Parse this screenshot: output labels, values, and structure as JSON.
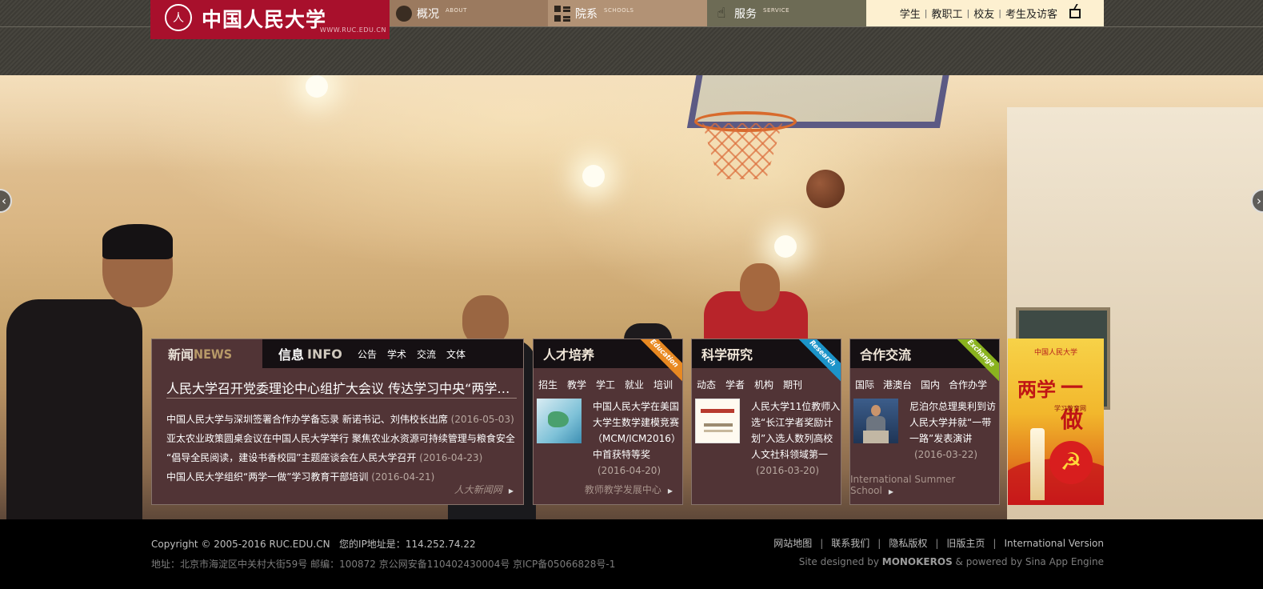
{
  "header": {
    "logo_name": "中国人民大学",
    "logo_seal": "人",
    "logo_url": "WWW.RUC.EDU.CN",
    "nav": [
      {
        "label": "概况",
        "sub": "ABOUT",
        "icon": "globe-icon"
      },
      {
        "label": "院系",
        "sub": "SCHOOLS",
        "icon": "grid-icon"
      },
      {
        "label": "服务",
        "sub": "SERVICE",
        "icon": "hand-pointer-icon"
      }
    ],
    "quick_links": [
      "学生",
      "教职工",
      "校友",
      "考生及访客"
    ],
    "quick_sep": "|",
    "tv_icon": "tv-icon"
  },
  "slider": {
    "prev": "‹",
    "next": "›"
  },
  "news": {
    "tab_news_cn": "新闻",
    "tab_news_en": "NEWS",
    "tab_info_cn": "信息",
    "tab_info_en": "INFO",
    "info_subtabs": [
      "公告",
      "学术",
      "交流",
      "文体"
    ],
    "headline": "人民大学召开党委理论中心组扩大会议 传达学习中央“两学一做”学习教育工作座谈会精神",
    "items": [
      {
        "title": "中国人民大学与深圳签署合作办学备忘录 新诺书记、刘伟校长出席",
        "date": "(2016-05-03)"
      },
      {
        "title": "亚太农业政策圆桌会议在中国人民大学举行 聚焦农业水资源可持续管理与粮食安全",
        "date": ""
      },
      {
        "title": "“倡导全民阅读，建设书香校园”主题座谈会在人民大学召开",
        "date": "(2016-04-23)"
      },
      {
        "title": "中国人民大学组织“两学一做”学习教育干部培训",
        "date": "(2016-04-21)"
      }
    ],
    "more": "人大新闻网"
  },
  "talent": {
    "title": "人才培养",
    "ribbon": "Education",
    "cats": [
      "招生",
      "教学",
      "学工",
      "就业",
      "培训"
    ],
    "item_text": "中国人民大学在美国大学生数学建模竞赛（MCM/ICM2016）中首获特等奖",
    "item_date": "(2016-04-20)",
    "more": "教师教学发展中心"
  },
  "research": {
    "title": "科学研究",
    "ribbon": "Research",
    "cats": [
      "动态",
      "学者",
      "机构",
      "期刊"
    ],
    "item_text": "人民大学11位教师入选“长江学者奖励计划”入选人数列高校人文社科领域第一",
    "item_date": "(2016-03-20)"
  },
  "coop": {
    "title": "合作交流",
    "ribbon": "Exchange",
    "cats": [
      "国际",
      "港澳台",
      "国内",
      "合作办学"
    ],
    "item_text": "尼泊尔总理奥利到访人民大学并就“一带一路”发表演讲",
    "item_date": "(2016-03-22)",
    "more": "International Summer School"
  },
  "promo": {
    "brand": "中国人民大学",
    "big1": "两",
    "big1b": "学",
    "big2": "一做",
    "sub": "学习教育网",
    "emblem": "☭"
  },
  "footer": {
    "copyright": "Copyright © 2005-2016 RUC.EDU.CN",
    "ip_label": "您的IP地址是：",
    "ip": "114.252.74.22",
    "address": "地址：北京市海淀区中关村大街59号 邮编：100872 京公网安备110402430004号 京ICP备05066828号-1",
    "links": [
      "网站地图",
      "联系我们",
      "隐私版权",
      "旧版主页",
      "International Version"
    ],
    "link_sep": "|",
    "credit_pre": "Site designed by ",
    "credit_brand": "MONOKEROS",
    "credit_post": " & powered by Sina App Engine"
  }
}
